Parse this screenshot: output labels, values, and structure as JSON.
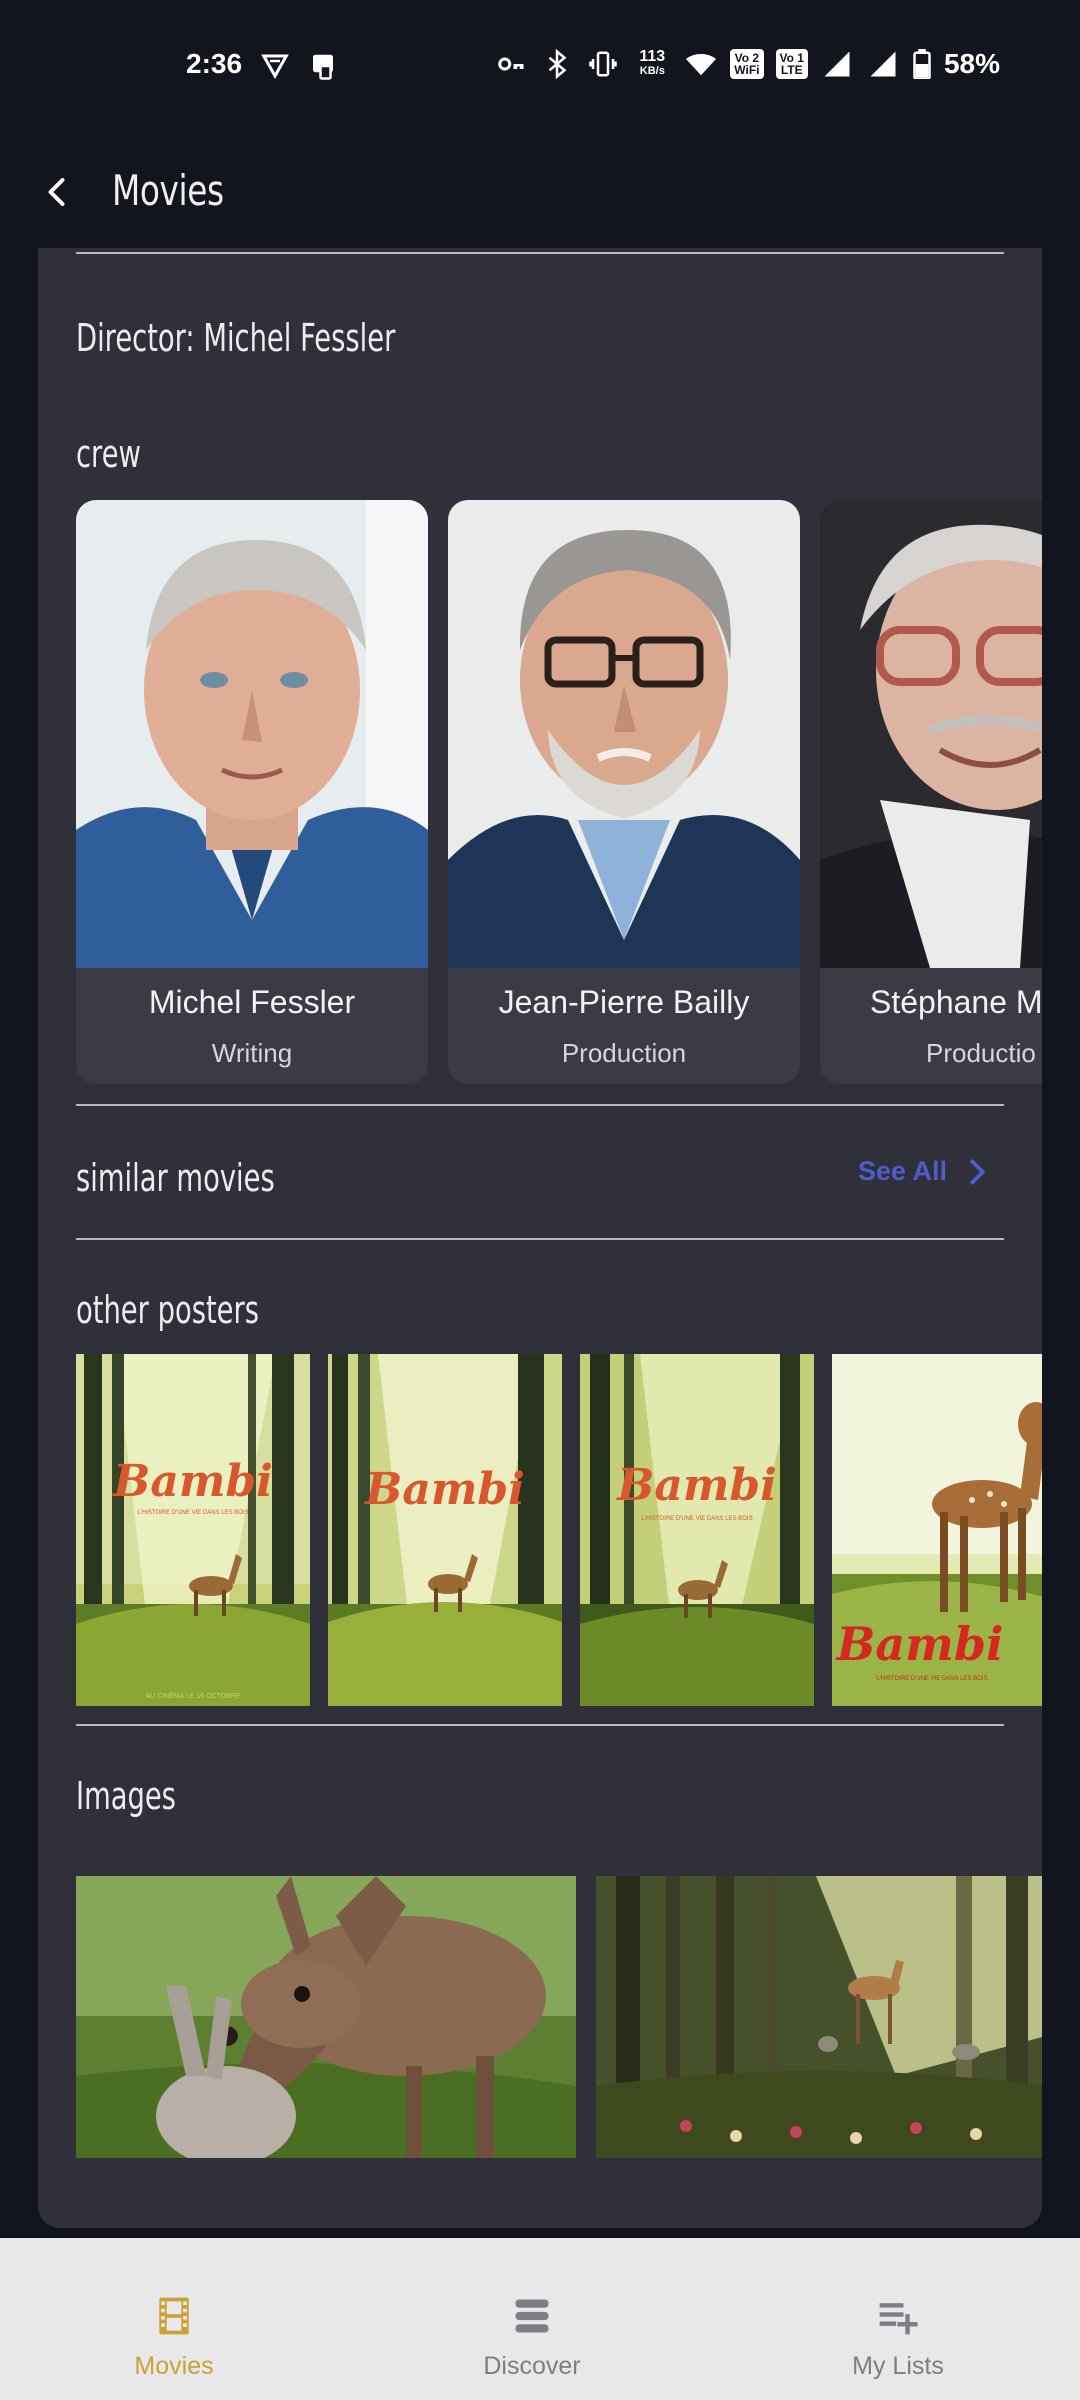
{
  "status_bar": {
    "time": "2:36",
    "net_speed_value": "113",
    "net_speed_unit": "KB/s",
    "chip_wifi_top": "Vo 2",
    "chip_wifi_bottom": "WiFi",
    "chip_lte_top": "Vo 1",
    "chip_lte_bottom": "LTE",
    "battery": "58%"
  },
  "app_bar": {
    "title": "Movies"
  },
  "details": {
    "director": "Director: Michel Fessler",
    "crew_title": "crew",
    "crew": [
      {
        "name": "Michel Fessler",
        "role": "Writing"
      },
      {
        "name": "Jean-Pierre Bailly",
        "role": "Production"
      },
      {
        "name": "Stéphane Mi",
        "role": "Productio"
      }
    ],
    "similar_title": "similar movies",
    "see_all": "See All",
    "posters_title": "other posters",
    "posters": [
      {
        "title": "BAMBI",
        "tagline": "L'HISTOIRE D'UNE VIE DANS LES BOIS",
        "footer": "AU CINÉMA LE 16 OCTOBRE"
      },
      {
        "title": "BAMBI",
        "tagline": "",
        "footer": ""
      },
      {
        "title": "BAMBI",
        "tagline": "L'HISTOIRE D'UNE VIE DANS LES BOIS",
        "footer": ""
      },
      {
        "title": "BAMBI",
        "tagline": "L'HISTOIRE D'UNE VIE DANS LES BOIS",
        "footer": ""
      }
    ],
    "images_title": "Images"
  },
  "nav": {
    "items": [
      {
        "label": "Movies",
        "icon": "film-icon"
      },
      {
        "label": "Discover",
        "icon": "stack-icon"
      },
      {
        "label": "My Lists",
        "icon": "playlist-add-icon"
      }
    ]
  },
  "colors": {
    "accent": "#c9a233",
    "link": "#4f5cc9",
    "card": "#2f3039",
    "background": "#12151d"
  }
}
